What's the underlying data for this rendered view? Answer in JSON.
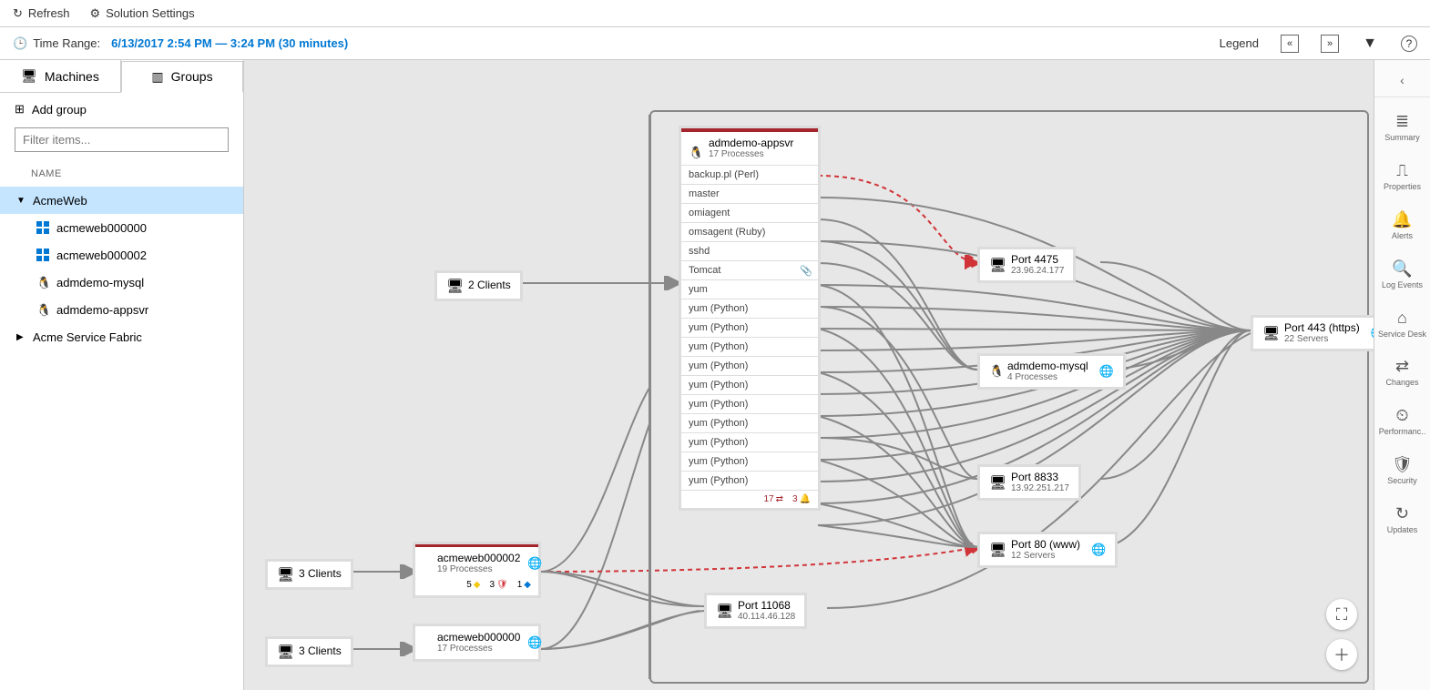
{
  "topbar": {
    "refresh": "Refresh",
    "settings": "Solution Settings"
  },
  "timebar": {
    "label": "Time Range:",
    "value": "6/13/2017 2:54 PM — 3:24 PM (30 minutes)",
    "legend": "Legend"
  },
  "sidebar": {
    "tabs": {
      "machines": "Machines",
      "groups": "Groups"
    },
    "addgroup": "Add group",
    "filter_placeholder": "Filter items...",
    "name_header": "NAME",
    "tree": [
      {
        "label": "AcmeWeb",
        "expanded": true,
        "selected": true,
        "children": [
          {
            "label": "acmeweb000000",
            "os": "win"
          },
          {
            "label": "acmeweb000002",
            "os": "win"
          },
          {
            "label": "admdemo-mysql",
            "os": "linux"
          },
          {
            "label": "admdemo-appsvr",
            "os": "linux"
          }
        ]
      },
      {
        "label": "Acme Service Fabric",
        "expanded": false
      }
    ]
  },
  "canvas": {
    "clients": [
      {
        "label": "2 Clients"
      },
      {
        "label": "3 Clients"
      },
      {
        "label": "3 Clients"
      }
    ],
    "machines": {
      "m1": {
        "name": "acmeweb000002",
        "sub": "19 Processes",
        "os": "win",
        "badges": [
          {
            "n": "5",
            "color": "#f2c811"
          },
          {
            "n": "3",
            "color": "#d13438"
          },
          {
            "n": "1",
            "color": "#0078d4"
          }
        ]
      },
      "m2": {
        "name": "acmeweb000000",
        "sub": "17 Processes",
        "os": "win"
      }
    },
    "appsvr": {
      "name": "admdemo-appsvr",
      "sub": "17 Processes",
      "processes": [
        "backup.pl (Perl)",
        "master",
        "omiagent",
        "omsagent (Ruby)",
        "sshd",
        "Tomcat",
        "yum",
        "yum (Python)",
        "yum (Python)",
        "yum (Python)",
        "yum (Python)",
        "yum (Python)",
        "yum (Python)",
        "yum (Python)",
        "yum (Python)",
        "yum (Python)",
        "yum (Python)"
      ],
      "tomcat_index": 5,
      "footer": {
        "a": "17",
        "b": "3"
      }
    },
    "targets": {
      "p4475": {
        "title": "Port 4475",
        "sub": "23.96.24.177"
      },
      "mysql": {
        "title": "admdemo-mysql",
        "sub": "4 Processes"
      },
      "p8833": {
        "title": "Port 8833",
        "sub": "13.92.251.217"
      },
      "p80": {
        "title": "Port 80 (www)",
        "sub": "12 Servers"
      },
      "p443": {
        "title": "Port 443 (https)",
        "sub": "22 Servers"
      },
      "p11068": {
        "title": "Port 11068",
        "sub": "40.114.46.128"
      }
    }
  },
  "rail": {
    "items": [
      {
        "icon": "≣",
        "label": "Summary"
      },
      {
        "icon": "⎍",
        "label": "Properties"
      },
      {
        "icon": "🔔",
        "label": "Alerts"
      },
      {
        "icon": "🔍",
        "label": "Log Events"
      },
      {
        "icon": "⌂",
        "label": "Service Desk"
      },
      {
        "icon": "⇄",
        "label": "Changes"
      },
      {
        "icon": "⏲",
        "label": "Performanc.."
      },
      {
        "icon": "🛡",
        "label": "Security"
      },
      {
        "icon": "↻",
        "label": "Updates"
      }
    ]
  }
}
